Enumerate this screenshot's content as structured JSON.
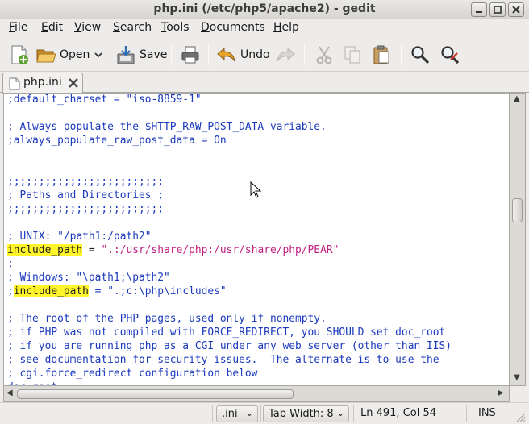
{
  "window": {
    "title": "php.ini (/etc/php5/apache2) - gedit"
  },
  "menubar": {
    "items": [
      {
        "accel": "F",
        "rest": "ile"
      },
      {
        "accel": "E",
        "rest": "dit"
      },
      {
        "accel": "V",
        "rest": "iew"
      },
      {
        "accel": "S",
        "rest": "earch"
      },
      {
        "accel": "T",
        "rest": "ools"
      },
      {
        "accel": "D",
        "rest": "ocuments"
      },
      {
        "accel": "H",
        "rest": "elp"
      }
    ]
  },
  "toolbar": {
    "open_label": "Open",
    "save_label": "Save",
    "undo_label": "Undo"
  },
  "tab": {
    "label": "php.ini"
  },
  "editor": {
    "lines": [
      [
        {
          "t": ";default_charset = \"iso-8859-1\"",
          "c": "cmt"
        }
      ],
      [],
      [
        {
          "t": "; Always populate the $HTTP_RAW_POST_DATA variable.",
          "c": "cmt"
        }
      ],
      [
        {
          "t": ";always_populate_raw_post_data = On",
          "c": "cmt"
        }
      ],
      [],
      [],
      [
        {
          "t": ";;;;;;;;;;;;;;;;;;;;;;;;;",
          "c": "cmt"
        }
      ],
      [
        {
          "t": "; Paths and Directories ;",
          "c": "cmt"
        }
      ],
      [
        {
          "t": ";;;;;;;;;;;;;;;;;;;;;;;;;",
          "c": "cmt"
        }
      ],
      [],
      [
        {
          "t": "; UNIX: \"/path1:/path2\"",
          "c": "cmt"
        }
      ],
      [
        {
          "t": "include_path",
          "c": "hl"
        },
        {
          "t": " = ",
          "c": "plain"
        },
        {
          "t": "\".:/usr/share/php:/usr/share/php/PEAR\"",
          "c": "str"
        }
      ],
      [
        {
          "t": ";",
          "c": "cmt"
        }
      ],
      [
        {
          "t": "; Windows: \"\\path1;\\path2\"",
          "c": "cmt"
        }
      ],
      [
        {
          "t": ";",
          "c": "cmt"
        },
        {
          "t": "include_path",
          "c": "hl"
        },
        {
          "t": " = \".;c:\\php\\includes\"",
          "c": "cmt"
        }
      ],
      [],
      [
        {
          "t": "; The root of the PHP pages, used only if nonempty.",
          "c": "cmt"
        }
      ],
      [
        {
          "t": "; if PHP was not compiled with FORCE_REDIRECT, you SHOULD set doc_root",
          "c": "cmt"
        }
      ],
      [
        {
          "t": "; if you are running php as a CGI under any web server (other than IIS)",
          "c": "cmt"
        }
      ],
      [
        {
          "t": "; see documentation for security issues.  The alternate is to use the",
          "c": "cmt"
        }
      ],
      [
        {
          "t": "; cgi.force_redirect configuration below",
          "c": "cmt"
        }
      ],
      [
        {
          "t": "doc_root =",
          "c": "cmt"
        }
      ]
    ]
  },
  "statusbar": {
    "language": ".ini",
    "tab_width": "Tab Width: 8",
    "position": "Ln 491, Col 54",
    "mode": "INS"
  },
  "colors": {
    "comment": "#1a39bd",
    "string": "#c2227f",
    "highlight": "#fff52a"
  }
}
